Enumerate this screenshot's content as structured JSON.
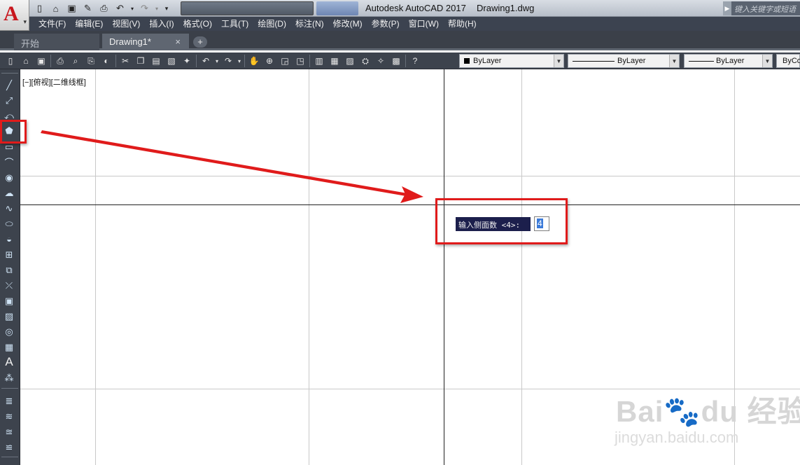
{
  "app": {
    "title": "Autodesk AutoCAD 2017",
    "filename": "Drawing1.dwg",
    "search_placeholder": "键入关键字或短语",
    "logo_letter": "A"
  },
  "menu": [
    "文件(F)",
    "编辑(E)",
    "视图(V)",
    "插入(I)",
    "格式(O)",
    "工具(T)",
    "绘图(D)",
    "标注(N)",
    "修改(M)",
    "参数(P)",
    "窗口(W)",
    "帮助(H)"
  ],
  "tabs": {
    "start": "开始",
    "drawing": "Drawing1*",
    "close": "×",
    "add": "+"
  },
  "properties": {
    "color": "ByLayer",
    "linetype": "ByLayer",
    "lineweight": "ByLayer",
    "plotstyle": "ByCo"
  },
  "viewport": {
    "label": "[−][俯视][二维线框]"
  },
  "command": {
    "prompt": "输入侧面数 <4>:",
    "input_value": "4"
  },
  "watermark": {
    "url": "jingyan.baidu.com"
  },
  "colors": {
    "annotation": "#e01b1b",
    "prompt_bg": "#1c1f4c",
    "ui_dark": "#3d434d"
  }
}
